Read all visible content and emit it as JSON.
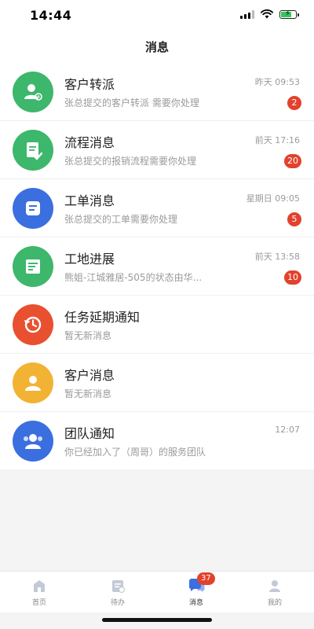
{
  "status_bar": {
    "time": "14:44"
  },
  "nav": {
    "title": "消息"
  },
  "messages": [
    {
      "title": "客户转派",
      "subtitle": "张总提交的客户转派 需要你处理",
      "time": "昨天 09:53",
      "badge": "2",
      "color": "#3db76b",
      "icon": "user-transfer-icon"
    },
    {
      "title": "流程消息",
      "subtitle": "张总提交的报销流程需要你处理",
      "time": "前天 17:16",
      "badge": "20",
      "color": "#3db76b",
      "icon": "document-check-icon"
    },
    {
      "title": "工单消息",
      "subtitle": "张总提交的工单需要你处理",
      "time": "星期日 09:05",
      "badge": "5",
      "color": "#3b6fe0",
      "icon": "work-order-icon"
    },
    {
      "title": "工地进展",
      "subtitle": "熊姐-江城雅居-505的状态由华...",
      "time": "前天 13:58",
      "badge": "10",
      "color": "#3db76b",
      "icon": "progress-list-icon"
    },
    {
      "title": "任务延期通知",
      "subtitle": "暂无新消息",
      "time": "",
      "badge": "",
      "color": "#e8502f",
      "icon": "clock-delay-icon"
    },
    {
      "title": "客户消息",
      "subtitle": "暂无新消息",
      "time": "",
      "badge": "",
      "color": "#f2b233",
      "icon": "customer-icon"
    },
    {
      "title": "团队通知",
      "subtitle": "你已经加入了（周哥）的服务团队",
      "time": "12:07",
      "badge": "",
      "color": "#3b6fe0",
      "icon": "team-icon"
    }
  ],
  "tabs": [
    {
      "label": "首页",
      "icon": "home-icon",
      "active": false,
      "badge": ""
    },
    {
      "label": "待办",
      "icon": "todo-icon",
      "active": false,
      "badge": ""
    },
    {
      "label": "消息",
      "icon": "message-icon",
      "active": true,
      "badge": "37"
    },
    {
      "label": "我的",
      "icon": "profile-icon",
      "active": false,
      "badge": ""
    }
  ]
}
